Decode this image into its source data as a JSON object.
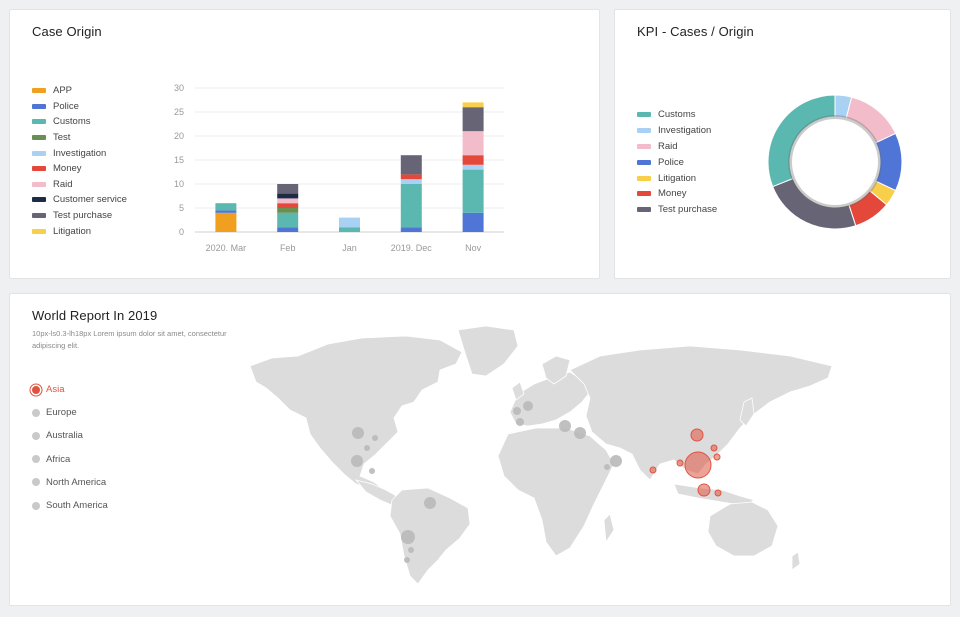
{
  "case_origin": {
    "title": "Case Origin",
    "legend": [
      {
        "label": "APP",
        "color": "#f0a01e"
      },
      {
        "label": "Police",
        "color": "#4f76d6"
      },
      {
        "label": "Customs",
        "color": "#5bb8b1"
      },
      {
        "label": "Test",
        "color": "#6a8f52"
      },
      {
        "label": "Investigation",
        "color": "#a9d1f4"
      },
      {
        "label": "Money",
        "color": "#e3483a"
      },
      {
        "label": "Raid",
        "color": "#f3bccb"
      },
      {
        "label": "Customer service",
        "color": "#1d2b46"
      },
      {
        "label": "Test purchase",
        "color": "#676575"
      },
      {
        "label": "Litigation",
        "color": "#f8cf4a"
      }
    ]
  },
  "kpi": {
    "title": "KPI - Cases / Origin",
    "legend": [
      {
        "label": "Customs",
        "color": "#5bb8b1"
      },
      {
        "label": "Investigation",
        "color": "#a9d1f4"
      },
      {
        "label": "Raid",
        "color": "#f3bccb"
      },
      {
        "label": "Police",
        "color": "#4f76d6"
      },
      {
        "label": "Litigation",
        "color": "#f8cf4a"
      },
      {
        "label": "Money",
        "color": "#e3483a"
      },
      {
        "label": "Test purchase",
        "color": "#676575"
      }
    ]
  },
  "world": {
    "title": "World Report In 2019",
    "subtitle": "10px-ls0.3-lh18px Lorem ipsum dolor sit amet, consectetur adipiscing elit.",
    "regions": [
      {
        "label": "Asia",
        "active": true
      },
      {
        "label": "Europe",
        "active": false
      },
      {
        "label": "Australia",
        "active": false
      },
      {
        "label": "Africa",
        "active": false
      },
      {
        "label": "North America",
        "active": false
      },
      {
        "label": "South America",
        "active": false
      }
    ],
    "active_color": "#e0533f",
    "inactive_color": "#b9b9b9"
  },
  "chart_data": [
    {
      "type": "bar",
      "stacked": true,
      "title": "Case Origin",
      "categories": [
        "2020. Mar",
        "Feb",
        "Jan",
        "2019. Dec",
        "Nov"
      ],
      "ylim": [
        0,
        30
      ],
      "yticks": [
        0,
        5,
        10,
        15,
        20,
        25,
        30
      ],
      "grid": true,
      "legend_position": "left",
      "series": [
        {
          "name": "APP",
          "color": "#f0a01e",
          "values": [
            4,
            0,
            0,
            0,
            0
          ]
        },
        {
          "name": "Police",
          "color": "#4f76d6",
          "values": [
            0.5,
            1,
            0,
            1,
            4
          ]
        },
        {
          "name": "Customs",
          "color": "#5bb8b1",
          "values": [
            1.5,
            3,
            1,
            9,
            9
          ]
        },
        {
          "name": "Test",
          "color": "#6a8f52",
          "values": [
            0,
            1,
            0,
            0,
            0
          ]
        },
        {
          "name": "Investigation",
          "color": "#a9d1f4",
          "values": [
            0,
            0,
            2,
            1,
            1
          ]
        },
        {
          "name": "Money",
          "color": "#e3483a",
          "values": [
            0,
            1,
            0,
            1,
            2
          ]
        },
        {
          "name": "Raid",
          "color": "#f3bccb",
          "values": [
            0,
            1,
            0,
            0,
            5
          ]
        },
        {
          "name": "Customer service",
          "color": "#1d2b46",
          "values": [
            0,
            1,
            0,
            0,
            0
          ]
        },
        {
          "name": "Test purchase",
          "color": "#676575",
          "values": [
            0,
            2,
            0,
            4,
            5
          ]
        },
        {
          "name": "Litigation",
          "color": "#f8cf4a",
          "values": [
            0,
            0,
            0,
            0,
            1
          ]
        }
      ]
    },
    {
      "type": "pie",
      "donut": true,
      "title": "KPI - Cases / Origin",
      "legend_position": "left",
      "slices": [
        {
          "label": "Customs",
          "value": 31,
          "color": "#5bb8b1"
        },
        {
          "label": "Investigation",
          "value": 4,
          "color": "#a9d1f4"
        },
        {
          "label": "Raid",
          "value": 14,
          "color": "#f3bccb"
        },
        {
          "label": "Police",
          "value": 14,
          "color": "#4f76d6"
        },
        {
          "label": "Litigation",
          "value": 4,
          "color": "#f8cf4a"
        },
        {
          "label": "Money",
          "value": 9,
          "color": "#e3483a"
        },
        {
          "label": "Test purchase",
          "value": 24,
          "color": "#676575"
        }
      ]
    }
  ]
}
